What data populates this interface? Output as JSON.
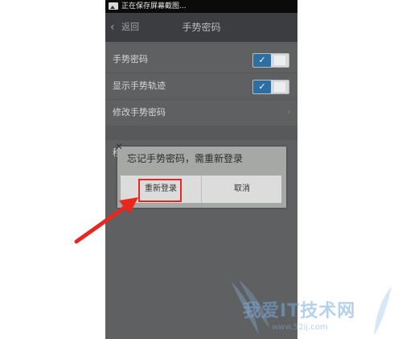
{
  "statusbar": {
    "text": "正在保存屏幕截图..."
  },
  "header": {
    "back_label": "返回",
    "title": "手势密码"
  },
  "settings": {
    "rows": [
      {
        "label": "手势密码",
        "toggle": "on"
      },
      {
        "label": "显示手势轨迹",
        "toggle": "on"
      },
      {
        "label": "修改手势密码"
      }
    ],
    "partial_row_label": "移"
  },
  "dialog": {
    "message": "忘记手势密码，需重新登录",
    "confirm_label": "重新登录",
    "cancel_label": "取消"
  },
  "icons": {
    "check": "✓",
    "back": "‹",
    "chevron": "›",
    "close": "✕"
  },
  "colors": {
    "toggle_on": "#2d6fa3",
    "annotation_red": "#e8271f"
  },
  "watermark": {
    "text": "我爱IT技术网",
    "url": "www.52ij.com"
  }
}
